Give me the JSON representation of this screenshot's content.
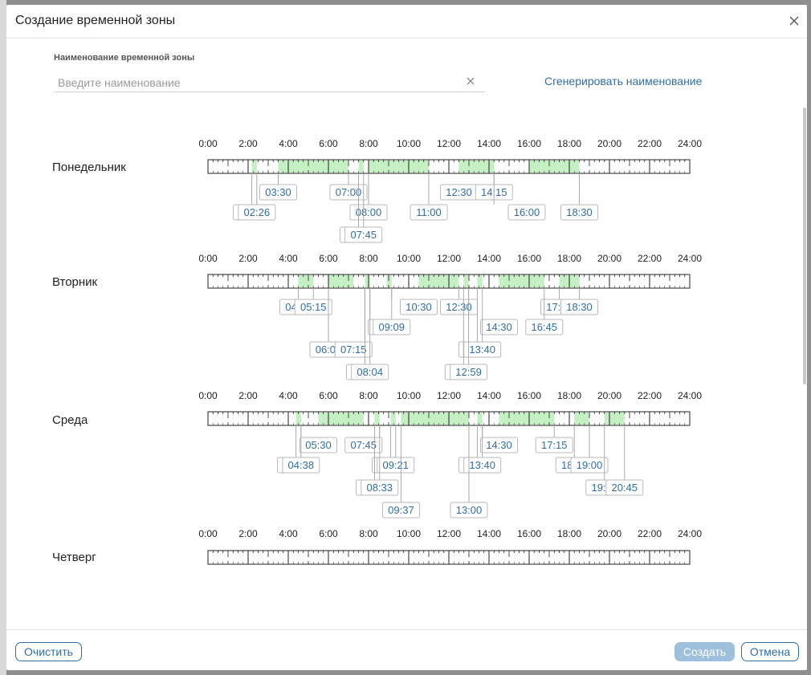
{
  "dialog": {
    "title": "Создание временной зоны"
  },
  "name_field": {
    "label": "Наименование временной зоны",
    "placeholder": "Введите наименование",
    "value": ""
  },
  "generate_link": "Сгенерировать наименование",
  "buttons": {
    "clear": "Очистить",
    "create": "Создать",
    "cancel": "Отмена"
  },
  "colors": {
    "accent": "#2f6ea6",
    "interval_fill": "#c4f0c4",
    "primary_disabled": "#9ec0dc"
  },
  "hour_labels": [
    "0:00",
    "2:00",
    "4:00",
    "6:00",
    "8:00",
    "10:00",
    "12:00",
    "14:00",
    "16:00",
    "18:00",
    "20:00",
    "22:00",
    "24:00"
  ],
  "days": [
    {
      "name": "Понедельник",
      "intervals": [
        [
          "02:11",
          "02:26"
        ],
        [
          "03:30",
          "07:00"
        ],
        [
          "07:30",
          "07:45"
        ],
        [
          "08:00",
          "11:00"
        ],
        [
          "12:30",
          "14:15"
        ],
        [
          "16:00",
          "18:30"
        ]
      ],
      "tags": [
        [
          "03:30",
          1,
          "03:30"
        ],
        [
          "02:11",
          2,
          "02:11"
        ],
        [
          "02:26",
          2,
          "02:26"
        ],
        [
          "07:00",
          1,
          "07:00"
        ],
        [
          "08:00",
          2,
          "08:00"
        ],
        [
          "07:30",
          3,
          "07:30"
        ],
        [
          "07:45",
          3,
          "07:45"
        ],
        [
          "12:30",
          1,
          "11:00"
        ],
        [
          "11:00",
          2,
          "11:00"
        ],
        [
          "14:15",
          1,
          "14:15"
        ],
        [
          "16:00",
          2,
          "14:15"
        ],
        [
          "18:30",
          2,
          "18:30"
        ]
      ]
    },
    {
      "name": "Вторник",
      "intervals": [
        [
          "04:30",
          "05:15"
        ],
        [
          "06:00",
          "07:15"
        ],
        [
          "07:49",
          "08:04"
        ],
        [
          "08:54",
          "09:09"
        ],
        [
          "10:30",
          "12:30"
        ],
        [
          "12:44",
          "12:59"
        ],
        [
          "13:25",
          "13:40"
        ],
        [
          "14:30",
          "16:45"
        ],
        [
          "17:30",
          "18:30"
        ]
      ],
      "tags": [
        [
          "04:30",
          1,
          "04:30"
        ],
        [
          "05:15",
          1,
          "05:15"
        ],
        [
          "10:30",
          1,
          "09:09"
        ],
        [
          "12:30",
          1,
          "12:30"
        ],
        [
          "17:30",
          1,
          "17:30"
        ],
        [
          "18:30",
          1,
          "18:30"
        ],
        [
          "08:54",
          2,
          "08:04"
        ],
        [
          "09:09",
          2,
          "09:09"
        ],
        [
          "14:30",
          2,
          "12:59"
        ],
        [
          "16:45",
          2,
          "16:45"
        ],
        [
          "06:00",
          3,
          "06:00"
        ],
        [
          "07:15",
          3,
          "07:49"
        ],
        [
          "13:25",
          3,
          "13:25"
        ],
        [
          "13:40",
          3,
          "13:40"
        ],
        [
          "07:49",
          4,
          "07:49"
        ],
        [
          "08:04",
          4,
          "08:04"
        ],
        [
          "12:44",
          4,
          "12:44"
        ],
        [
          "12:59",
          4,
          "12:59"
        ]
      ]
    },
    {
      "name": "Среда",
      "intervals": [
        [
          "04:23",
          "04:38"
        ],
        [
          "05:30",
          "07:45"
        ],
        [
          "08:18",
          "08:33"
        ],
        [
          "09:06",
          "09:21"
        ],
        [
          "09:37",
          "13:00"
        ],
        [
          "13:25",
          "13:40"
        ],
        [
          "14:30",
          "17:15"
        ],
        [
          "18:15",
          "19:00"
        ],
        [
          "19:45",
          "20:45"
        ]
      ],
      "tags": [
        [
          "05:30",
          1,
          "04:38"
        ],
        [
          "07:45",
          1,
          "08:33"
        ],
        [
          "14:30",
          1,
          "13:40"
        ],
        [
          "17:15",
          1,
          "17:15"
        ],
        [
          "04:23",
          2,
          "04:23"
        ],
        [
          "04:38",
          2,
          "04:38"
        ],
        [
          "09:06",
          2,
          "09:06"
        ],
        [
          "09:21",
          2,
          "09:21"
        ],
        [
          "13:25",
          2,
          "13:25"
        ],
        [
          "13:40",
          2,
          "13:40"
        ],
        [
          "18:15",
          2,
          "18:15"
        ],
        [
          "19:00",
          2,
          "19:00"
        ],
        [
          "08:18",
          3,
          "08:18"
        ],
        [
          "08:33",
          3,
          "08:33"
        ],
        [
          "19:45",
          3,
          "19:45"
        ],
        [
          "20:45",
          3,
          "20:45"
        ],
        [
          "09:37",
          4,
          "09:37"
        ],
        [
          "13:00",
          4,
          "13:00"
        ]
      ]
    },
    {
      "name": "Четверг",
      "intervals": [],
      "tags": []
    }
  ]
}
